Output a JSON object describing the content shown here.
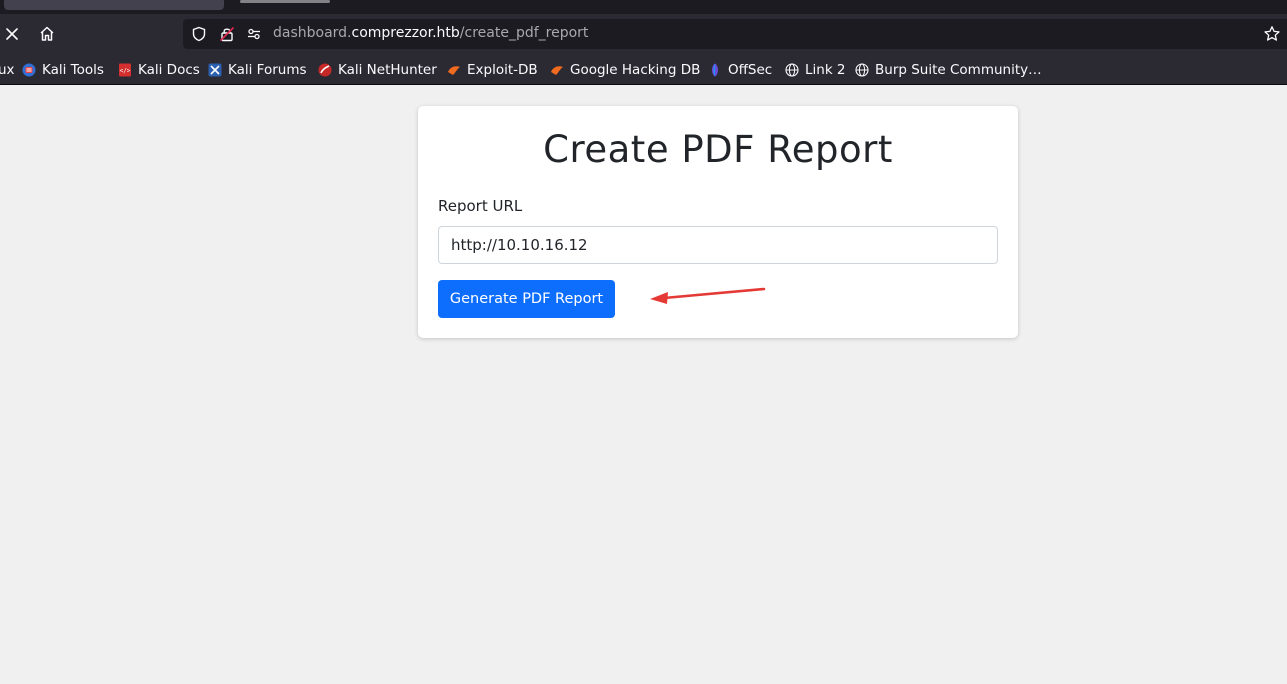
{
  "browser": {
    "url_prefix": "dashboard.",
    "url_host": "comprezzor.htb",
    "url_path": "/create_pdf_report",
    "bookmarks": [
      {
        "label": "ux",
        "icon": "none"
      },
      {
        "label": "Kali Tools",
        "icon": "kali-tools-icon"
      },
      {
        "label": "Kali Docs",
        "icon": "kali-docs-icon"
      },
      {
        "label": "Kali Forums",
        "icon": "kali-forums-icon"
      },
      {
        "label": "Kali NetHunter",
        "icon": "kali-nethunter-icon"
      },
      {
        "label": "Exploit-DB",
        "icon": "exploit-db-icon"
      },
      {
        "label": "Google Hacking DB",
        "icon": "google-hacking-db-icon"
      },
      {
        "label": "OffSec",
        "icon": "offsec-icon"
      },
      {
        "label": "Link 2",
        "icon": "globe-icon"
      },
      {
        "label": "Burp Suite Community…",
        "icon": "globe-icon"
      }
    ]
  },
  "page": {
    "title": "Create PDF Report",
    "field_label": "Report URL",
    "field_value": "http://10.10.16.12",
    "submit_label": "Generate PDF Report"
  },
  "colors": {
    "primary_button": "#0d6efd",
    "annotation_arrow": "#e53935",
    "page_background": "#f0f0f0"
  }
}
